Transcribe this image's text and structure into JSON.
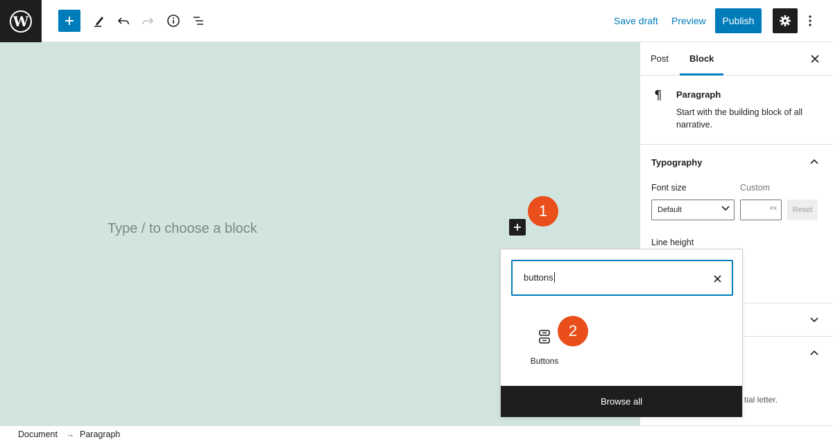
{
  "toolbar": {
    "logo_letter": "W",
    "icons": [
      "add-block-icon",
      "edit-pencil-icon",
      "undo-icon",
      "redo-icon",
      "info-icon",
      "list-view-icon"
    ],
    "save_draft": "Save draft",
    "preview": "Preview",
    "publish": "Publish"
  },
  "canvas": {
    "placeholder": "Type / to choose a block",
    "background": "#d2e4df"
  },
  "annotations": {
    "badge1": "1",
    "badge2": "2",
    "color": "#ea4e1b"
  },
  "sidebar": {
    "tabs": [
      {
        "label": "Post"
      },
      {
        "label": "Block"
      }
    ],
    "active_tab": "Block",
    "block": {
      "title": "Paragraph",
      "description": "Start with the building block of all narrative."
    },
    "typography": {
      "title": "Typography",
      "font_size_label": "Font size",
      "custom_label": "Custom",
      "select_value": "Default",
      "unit": "PX",
      "reset": "Reset",
      "line_height_label": "Line height"
    },
    "hint_fragment": "tial letter."
  },
  "inserter": {
    "search_value": "buttons",
    "result_label": "Buttons",
    "browse_all": "Browse all"
  },
  "breadcrumb": {
    "items": [
      "Document",
      "Paragraph"
    ],
    "separator": "→"
  },
  "colors": {
    "accent": "#007cba",
    "dark": "#1e1e1e"
  }
}
